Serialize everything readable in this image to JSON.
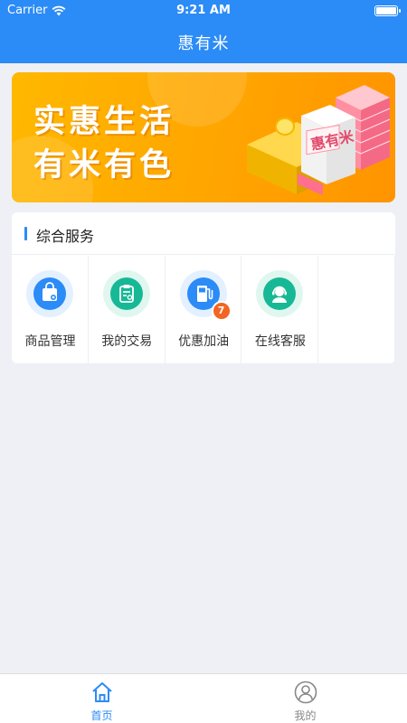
{
  "status_bar": {
    "carrier": "Carrier",
    "time": "9:21 AM"
  },
  "nav": {
    "title": "惠有米"
  },
  "banner": {
    "line1": "实惠生活",
    "line2": "有米有色",
    "badge": "惠有米",
    "colors": {
      "bg": "#ffa300",
      "accent": "#ff6f8e"
    }
  },
  "services": {
    "title": "综合服务",
    "items": [
      {
        "label": "商品管理",
        "icon": "shopping-bag-icon",
        "color": "#2b8bf7"
      },
      {
        "label": "我的交易",
        "icon": "clipboard-gear-icon",
        "color": "#17b895"
      },
      {
        "label": "优惠加油",
        "icon": "fuel-pump-icon",
        "color": "#2b8bf7",
        "badge": "7"
      },
      {
        "label": "在线客服",
        "icon": "customer-service-icon",
        "color": "#17b895"
      }
    ]
  },
  "tabbar": {
    "active_color": "#2b8bf7",
    "inactive_color": "#888888",
    "tabs": [
      {
        "label": "首页",
        "icon": "home-icon",
        "active": true
      },
      {
        "label": "我的",
        "icon": "user-profile-icon",
        "active": false
      }
    ]
  }
}
